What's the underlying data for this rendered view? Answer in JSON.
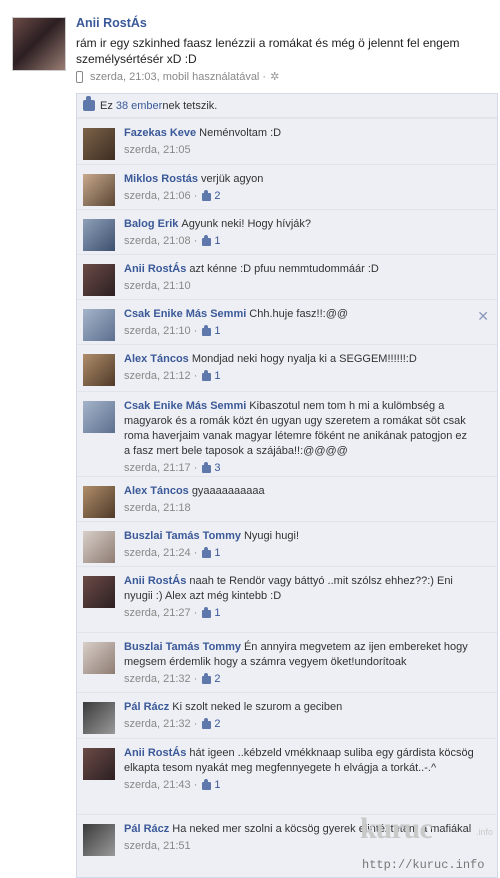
{
  "post": {
    "author": "Anii RostÁs",
    "text": "rám ir egy szkinhed faasz lenézzii a romákat és még ö jelennt fel engem személysértésér xD :D",
    "meta": "szerda, 21:03, mobil használatával ·",
    "icons": {
      "device": "mobile-phone-icon",
      "settings": "gear-icon"
    }
  },
  "likes": {
    "prefix": "Ez",
    "count_link": "38 ember",
    "suffix": "nek tetszik."
  },
  "comments": [
    {
      "author": "Fazekas Keve",
      "text": "Neménvoltam :D",
      "time": "szerda, 21:05",
      "likes": ""
    },
    {
      "author": "Miklos Rostás",
      "text": "verjük agyon",
      "time": "szerda, 21:06 ·",
      "likes": "2"
    },
    {
      "author": "Balog Erik",
      "text": "Agyunk neki! Hogy hívják?",
      "time": "szerda, 21:08 ·",
      "likes": "1"
    },
    {
      "author": "Anii RostÁs",
      "text": "azt kénne :D pfuu nemmtudommáár :D",
      "time": "szerda, 21:10",
      "likes": ""
    },
    {
      "author": "Csak Enike Más Semmi",
      "text": "Chh.huje fasz!!:@@",
      "time": "szerda, 21:10 ·",
      "likes": "1"
    },
    {
      "author": "Alex Táncos",
      "text": "Mondjad neki hogy nyalja ki a SEGGEM!!!!!!:D",
      "time": "szerda, 21:12 ·",
      "likes": "1"
    },
    {
      "author": "Csak Enike Más Semmi",
      "text": "Kibaszotul nem tom h mi a kulömbség a magyarok és a romák közt én ugyan ugy szeretem a romákat söt csak roma haverjaim vanak magyar létemre föként ne anikának patogjon ez a fasz mert bele taposok a szájába!!:@@@@",
      "time": "szerda, 21:17 ·",
      "likes": "3"
    },
    {
      "author": "Alex Táncos",
      "text": "gyaaaaaaaaaa",
      "time": "szerda, 21:18",
      "likes": ""
    },
    {
      "author": "Buszlai Tamás Tommy",
      "text": "Nyugi hugi!",
      "time": "szerda, 21:24 ·",
      "likes": "1"
    },
    {
      "author": "Anii RostÁs",
      "text": "naah te Rendör vagy báttyó ..mit szólsz ehhez??:) Eni nyugii :) Alex azt még kintebb :D",
      "time": "szerda, 21:27 ·",
      "likes": "1"
    },
    {
      "author": "Buszlai Tamás Tommy",
      "text": "Én annyira megvetem az ijen embereket hogy megsem érdemlik hogy a számra vegyem öket!undorítoak",
      "time": "szerda, 21:32 ·",
      "likes": "2"
    },
    {
      "author": "Pál Rácz",
      "text": "Ki szolt neked le szurom a geciben",
      "time": "szerda, 21:32 ·",
      "likes": "2"
    },
    {
      "author": "Anii RostÁs",
      "text": "hát igeen ..kébzeld vmékknaap suliba egy gárdista köcsög elkapta tesom nyakát meg megfennyegete h elvágja a torkát..-.^",
      "time": "szerda, 21:43 ·",
      "likes": "1"
    },
    {
      "author": "Pál Rácz",
      "text": "Ha neked mer szolni a köcsög gyerek elintéztetem a mafiákal",
      "time": "szerda, 21:51",
      "likes": ""
    }
  ],
  "watermark": {
    "logo": "kuruc",
    "tld": ".info",
    "url": "http://kuruc.info"
  },
  "colors": {
    "link": "#3b5998",
    "panel": "#edeff4",
    "meta": "#888888"
  }
}
